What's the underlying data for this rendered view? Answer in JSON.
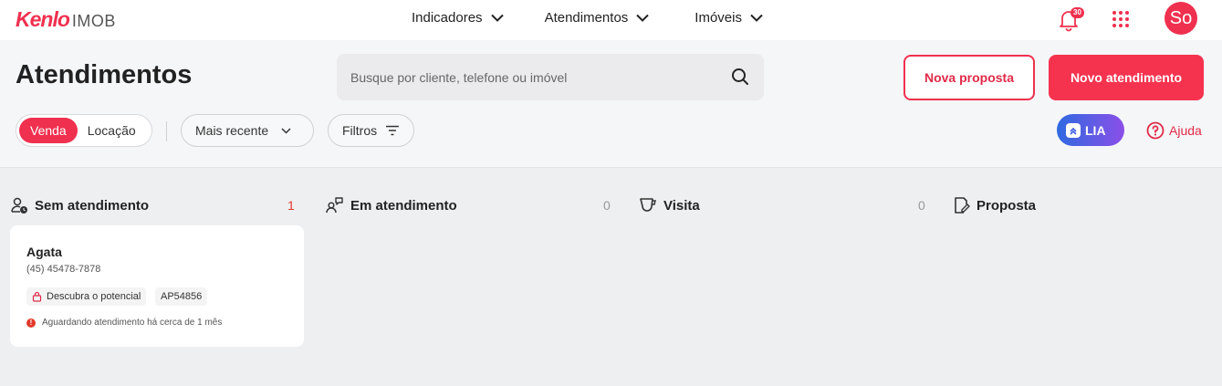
{
  "brand": {
    "logo_mark": "Kenlo",
    "logo_sub": "IMOB",
    "accent": "#f0304f"
  },
  "nav": {
    "items": [
      {
        "label": "Indicadores"
      },
      {
        "label": "Atendimentos"
      },
      {
        "label": "Imóveis"
      }
    ]
  },
  "notifications": {
    "count": "30"
  },
  "user": {
    "initials": "So"
  },
  "page": {
    "title": "Atendimentos"
  },
  "search": {
    "placeholder": "Busque por cliente, telefone ou imóvel",
    "value": ""
  },
  "actions": {
    "new_proposal": "Nova proposta",
    "new_service": "Novo atendimento"
  },
  "filters": {
    "mode_options": [
      "Venda",
      "Locação"
    ],
    "mode_selected": "Venda",
    "sort": "Mais recente",
    "filters_label": "Filtros",
    "lia_label": "LIA",
    "help_label": "Ajuda"
  },
  "board": {
    "columns": [
      {
        "title": "Sem atendimento",
        "count": "1",
        "count_color": "#e03a2a",
        "icon": "user-clock-icon"
      },
      {
        "title": "Em atendimento",
        "count": "0",
        "count_color": "#999999",
        "icon": "users-chat-icon"
      },
      {
        "title": "Visita",
        "count": "0",
        "count_color": "#999999",
        "icon": "coffee-cup-icon"
      },
      {
        "title": "Proposta",
        "count": "",
        "count_color": "#999999",
        "icon": "file-edit-icon"
      }
    ],
    "cards": [
      {
        "name": "Agata",
        "phone": "(45) 45478-7878",
        "tags": [
          "Descubra o potencial",
          "AP54856"
        ],
        "status": "Aguardando atendimento há cerca de 1 mês"
      }
    ]
  }
}
